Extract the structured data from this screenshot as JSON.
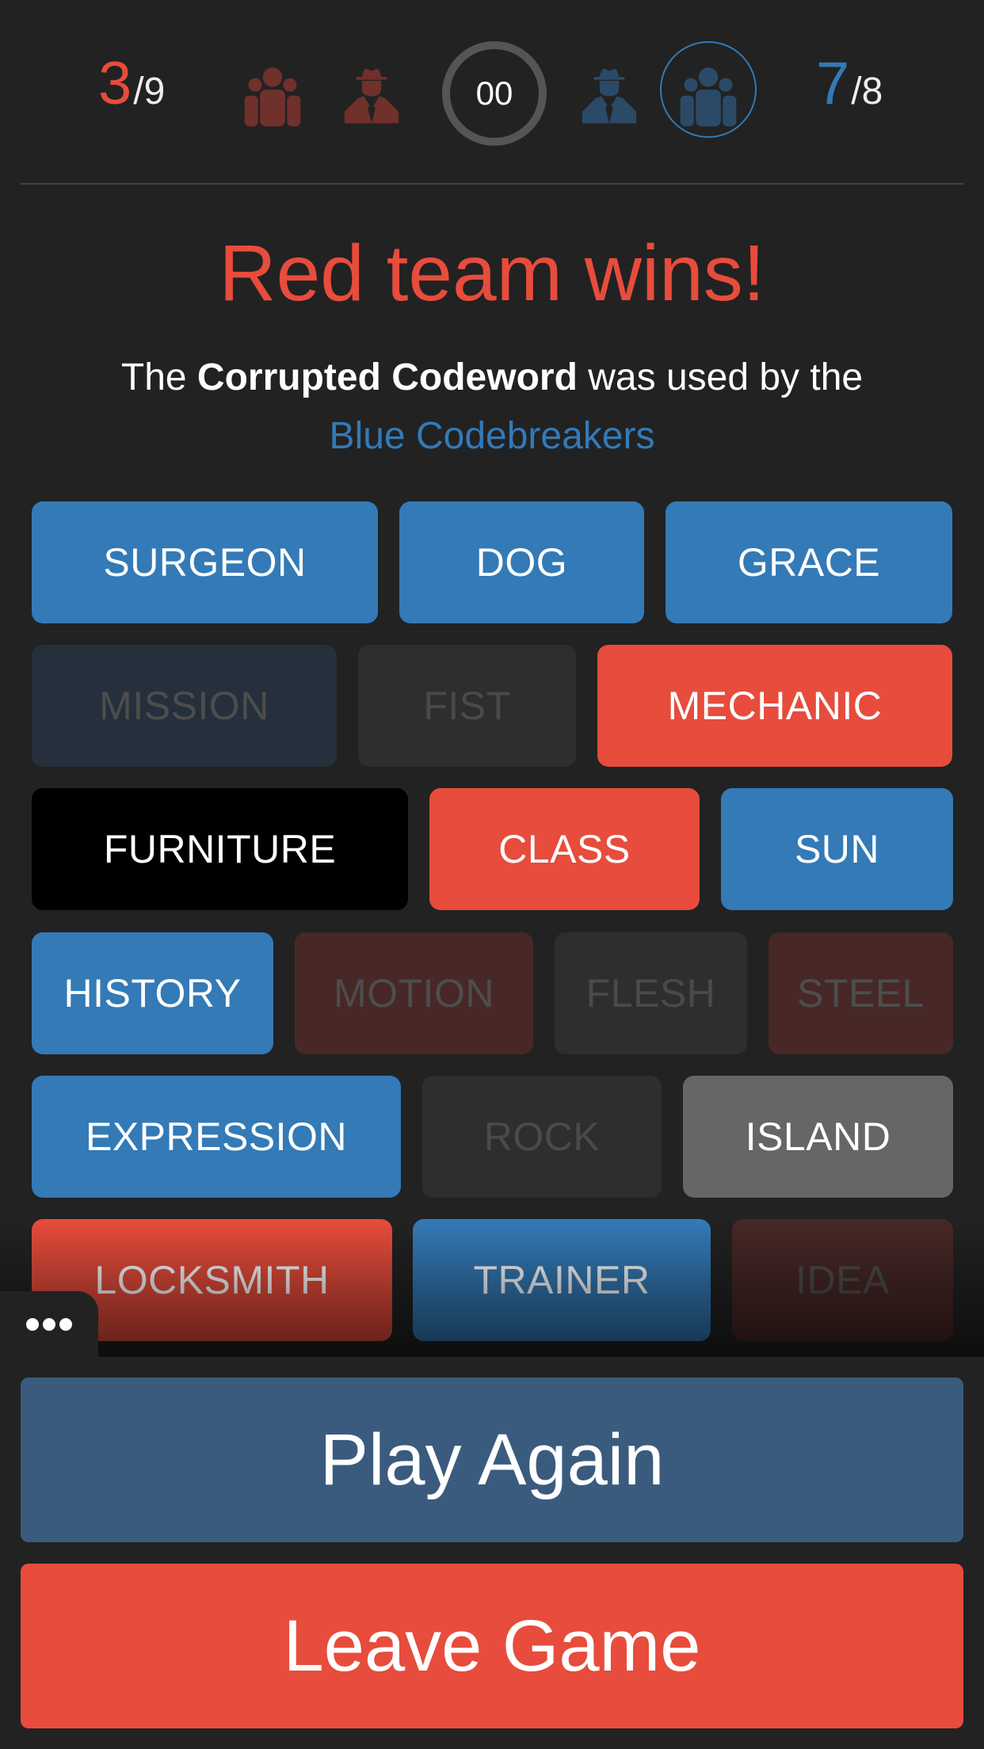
{
  "header": {
    "red_score": {
      "found": "3",
      "total": "/9"
    },
    "blue_score": {
      "found": "7",
      "total": "/8"
    },
    "timer": "00",
    "icons": {
      "red_team": "team-icon",
      "red_spymaster": "spymaster-icon",
      "blue_spymaster": "spymaster-icon",
      "blue_team": "team-icon"
    }
  },
  "result": {
    "title": "Red team wins!",
    "line_prefix": "The ",
    "line_bold": "Corrupted Codeword",
    "line_suffix": " was used by the",
    "team_name": "Blue Codebreakers"
  },
  "colors": {
    "red": "#e74c3c",
    "blue": "#337ab7",
    "background": "#222222",
    "play_again": "#3a5b7e"
  },
  "board": [
    [
      {
        "word": "SURGEON",
        "state": "blue"
      },
      {
        "word": "DOG",
        "state": "blue"
      },
      {
        "word": "GRACE",
        "state": "blue"
      }
    ],
    [
      {
        "word": "MISSION",
        "state": "blue-unrevealed"
      },
      {
        "word": "FIST",
        "state": "neutral-unrevealed"
      },
      {
        "word": "MECHANIC",
        "state": "red"
      }
    ],
    [
      {
        "word": "FURNITURE",
        "state": "assassin"
      },
      {
        "word": "CLASS",
        "state": "red"
      },
      {
        "word": "SUN",
        "state": "blue"
      }
    ],
    [
      {
        "word": "HISTORY",
        "state": "blue"
      },
      {
        "word": "MOTION",
        "state": "red-unrevealed"
      },
      {
        "word": "FLESH",
        "state": "neutral-unrevealed"
      },
      {
        "word": "STEEL",
        "state": "red-unrevealed"
      }
    ],
    [
      {
        "word": "EXPRESSION",
        "state": "blue"
      },
      {
        "word": "ROCK",
        "state": "neutral-unrevealed"
      },
      {
        "word": "ISLAND",
        "state": "neutral"
      }
    ],
    [
      {
        "word": "LOCKSMITH",
        "state": "red"
      },
      {
        "word": "TRAINER",
        "state": "blue"
      },
      {
        "word": "IDEA",
        "state": "red-unrevealed"
      }
    ]
  ],
  "menu": {
    "icon": "more-dots-icon"
  },
  "actions": {
    "play_again": "Play Again",
    "leave_game": "Leave Game"
  }
}
